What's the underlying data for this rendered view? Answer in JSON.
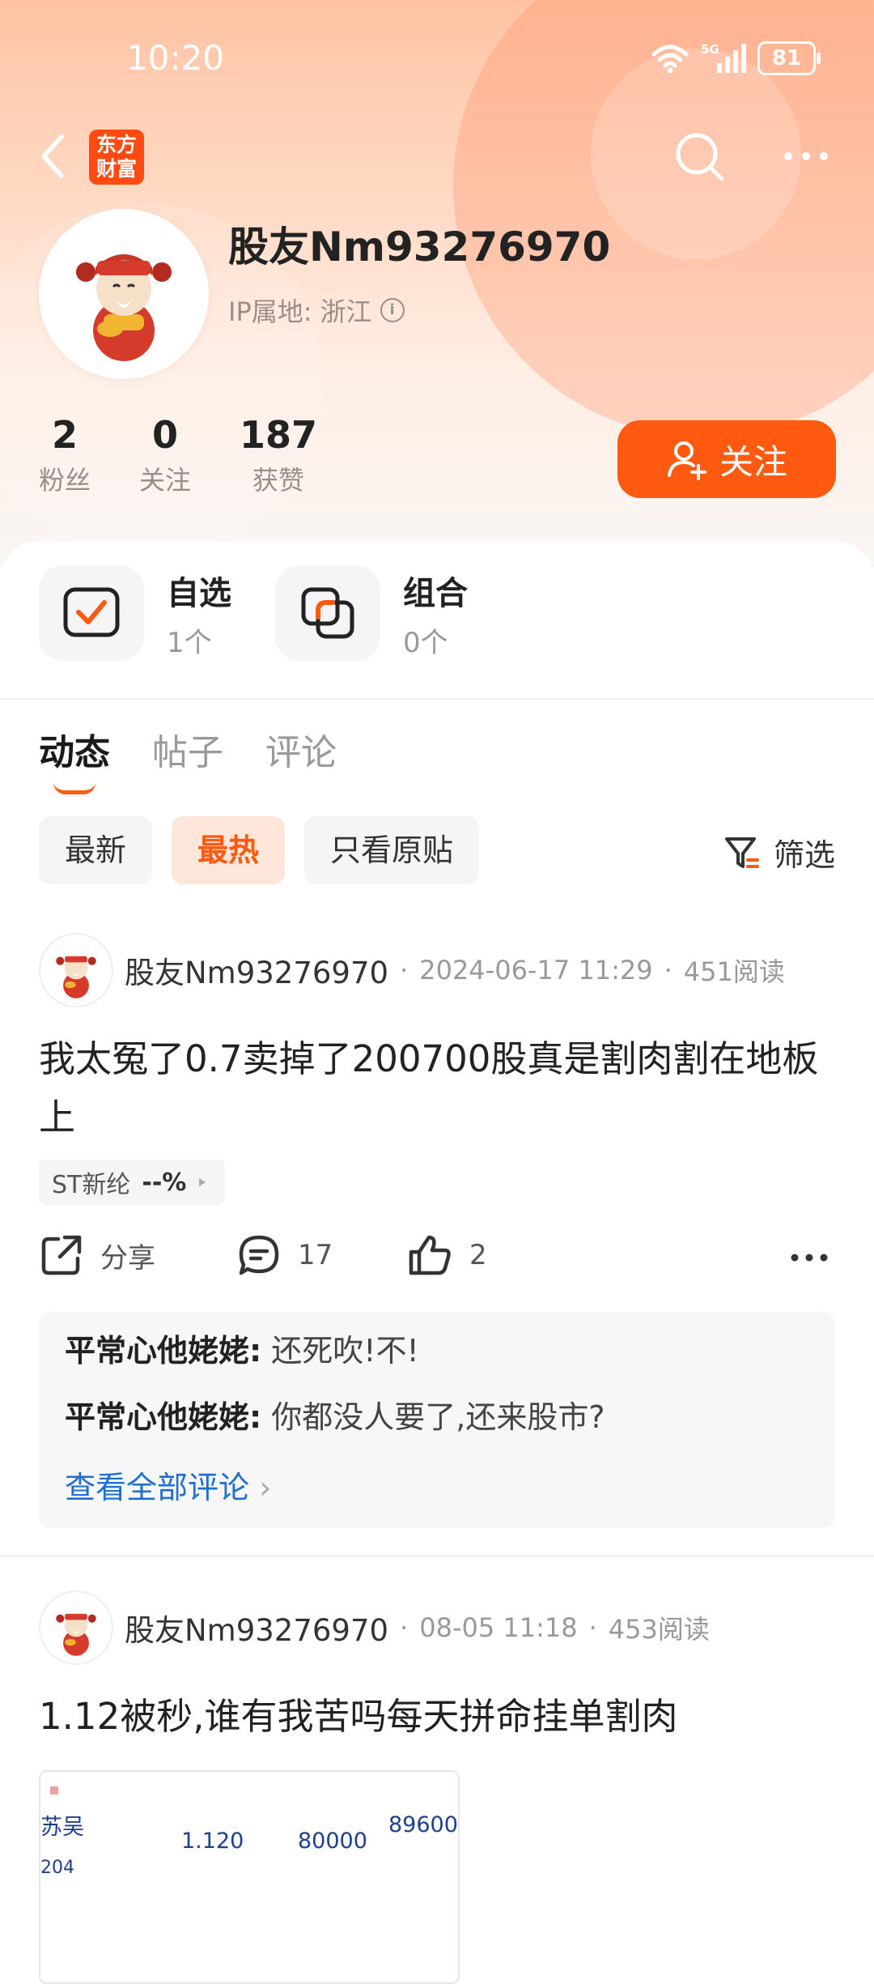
{
  "status_bar": {
    "time": "10:20",
    "network": "5G",
    "battery": "81"
  },
  "app": {
    "logo_line1": "东方",
    "logo_line2": "财富"
  },
  "profile": {
    "username": "股友Nm93276970",
    "ip_label": "IP属地:",
    "ip_location": "浙江",
    "stats": [
      {
        "value": "2",
        "label": "粉丝"
      },
      {
        "value": "0",
        "label": "关注"
      },
      {
        "value": "187",
        "label": "获赞"
      }
    ],
    "follow_button": "关注"
  },
  "quick_links": [
    {
      "title": "自选",
      "count": "1个"
    },
    {
      "title": "组合",
      "count": "0个"
    }
  ],
  "tabs": [
    "动态",
    "帖子",
    "评论"
  ],
  "filters": {
    "chips": [
      "最新",
      "最热",
      "只看原贴"
    ],
    "active": "最热",
    "filter_label": "筛选"
  },
  "colors": {
    "accent": "#ff5a0f",
    "link": "#1f6fd1"
  },
  "posts": [
    {
      "author": "股友Nm93276970",
      "date": "2024-06-17 11:29",
      "reads": "451阅读",
      "text": "我太冤了0.7卖掉了200700股真是割肉割在地板上",
      "stock_tag": {
        "name": "ST新纶",
        "change": "--%"
      },
      "share_label": "分享",
      "comment_count": "17",
      "like_count": "2",
      "comments": [
        {
          "user": "平常心他姥姥:",
          "text": "还死吹!不!"
        },
        {
          "user": "平常心他姥姥:",
          "text": "你都没人要了,还来股市?"
        }
      ],
      "view_all": "查看全部评论"
    },
    {
      "author": "股友Nm93276970",
      "date": "08-05 11:18",
      "reads": "453阅读",
      "text": "1.12被秒,谁有我苦吗每天拼命挂单割肉",
      "image_text": {
        "name": "苏吴",
        "code": "204",
        "price": "1.120",
        "qty": "80000",
        "amount": "89600"
      }
    }
  ]
}
